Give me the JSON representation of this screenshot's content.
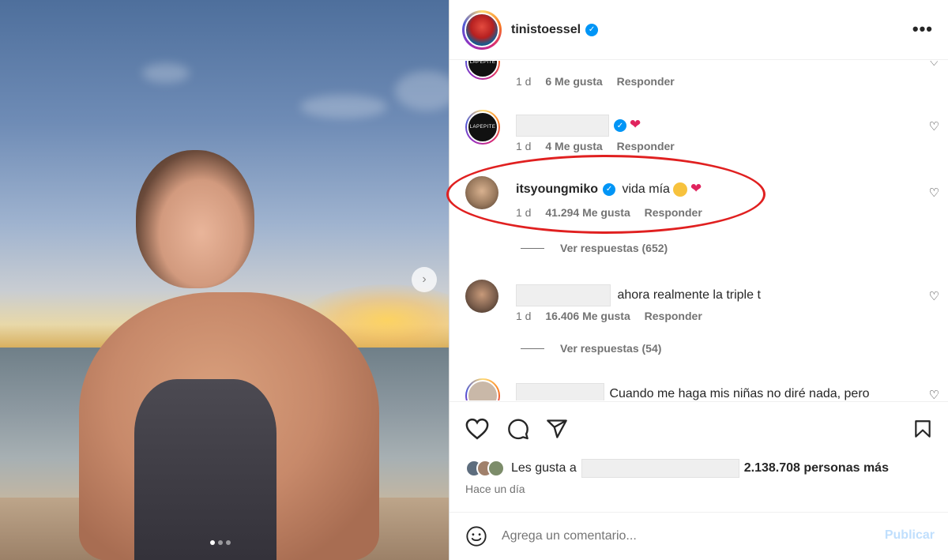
{
  "post": {
    "author": "tinistoessel",
    "verified": true,
    "image_indicator": {
      "total": 3,
      "current": 1
    }
  },
  "comments": [
    {
      "username": "",
      "text": "",
      "time": "1 d",
      "likes": "6 Me gusta",
      "reply": "Responder",
      "avatar_text": "LAPEPITE"
    },
    {
      "username": "",
      "text": "",
      "time": "1 d",
      "likes": "4 Me gusta",
      "reply": "Responder",
      "avatar_text": "LAPEPITE"
    },
    {
      "username": "itsyoungmiko",
      "text": "vida mía",
      "time": "1 d",
      "likes": "41.294 Me gusta",
      "reply": "Responder",
      "view_replies": "Ver respuestas (652)"
    },
    {
      "username": "",
      "text": "ahora realmente la triple t",
      "time": "1 d",
      "likes": "16.406 Me gusta",
      "reply": "Responder",
      "view_replies": "Ver respuestas (54)"
    },
    {
      "username": "",
      "text": "Cuando me haga mis niñas no diré nada, pero"
    }
  ],
  "likes_summary": {
    "prefix": "Les gusta a",
    "suffix": "2.138.708 personas más"
  },
  "timestamp": "Hace un día",
  "add_comment": {
    "placeholder": "Agrega un comentario...",
    "publish_label": "Publicar"
  },
  "colors": {
    "verified": "#0095f6",
    "highlight_oval": "#e02020",
    "publish_disabled": "#c0dffd"
  }
}
